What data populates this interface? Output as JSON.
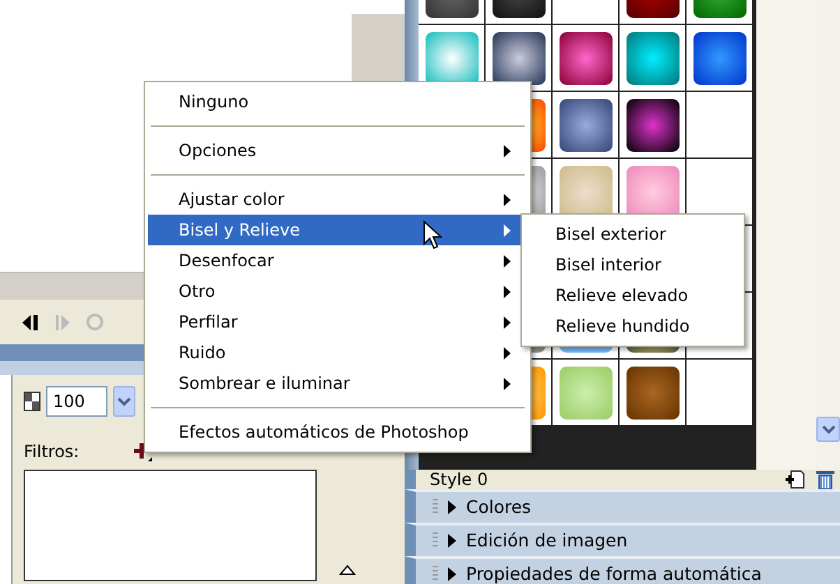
{
  "opacity_field": {
    "value": "100"
  },
  "filters": {
    "label": "Filtros:"
  },
  "styles_panel": {
    "style_name": "Style 0"
  },
  "sections": [
    {
      "label": "Colores",
      "expanded": false
    },
    {
      "label": "Edición de imagen",
      "expanded": false
    },
    {
      "label": "Propiedades de forma automática",
      "expanded": false
    }
  ],
  "context_menu": [
    {
      "kind": "item",
      "label": "Ninguno",
      "submenu": false,
      "selected": false
    },
    {
      "kind": "separator"
    },
    {
      "kind": "item",
      "label": "Opciones",
      "submenu": true,
      "selected": false
    },
    {
      "kind": "separator"
    },
    {
      "kind": "item",
      "label": "Ajustar color",
      "submenu": true,
      "selected": false
    },
    {
      "kind": "item",
      "label": "Bisel y Relieve",
      "submenu": true,
      "selected": true
    },
    {
      "kind": "item",
      "label": "Desenfocar",
      "submenu": true,
      "selected": false
    },
    {
      "kind": "item",
      "label": "Otro",
      "submenu": true,
      "selected": false
    },
    {
      "kind": "item",
      "label": "Perfilar",
      "submenu": true,
      "selected": false
    },
    {
      "kind": "item",
      "label": "Ruido",
      "submenu": true,
      "selected": false
    },
    {
      "kind": "item",
      "label": "Sombrear e iluminar",
      "submenu": true,
      "selected": false
    },
    {
      "kind": "separator"
    },
    {
      "kind": "item",
      "label": "Efectos automáticos de Photoshop",
      "submenu": false,
      "selected": false
    }
  ],
  "submenu": [
    {
      "label": "Bisel exterior",
      "selected": false
    },
    {
      "label": "Bisel interior",
      "selected": false
    },
    {
      "label": "Relieve elevado",
      "selected": false
    },
    {
      "label": "Relieve hundido",
      "selected": false
    }
  ]
}
